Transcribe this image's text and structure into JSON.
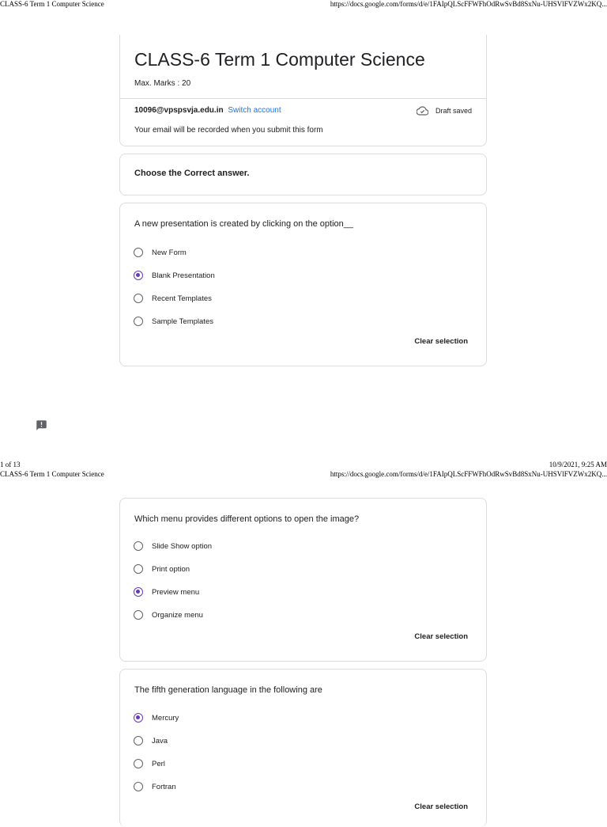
{
  "page1_header": {
    "left": "CLASS-6 Term 1 Computer Science",
    "right": "https://docs.google.com/forms/d/e/1FAIpQLScFFWFhOdRwSvBd8SxNu-UHSVlFVZWx2KQ..."
  },
  "page1_footer": {
    "left": "1 of 13",
    "right": "10/9/2021, 9:25 AM"
  },
  "page2_header": {
    "left": "CLASS-6 Term 1 Computer Science",
    "right": "https://docs.google.com/forms/d/e/1FAIpQLScFFWFhOdRwSvBd8SxNu-UHSVlFVZWx2KQ..."
  },
  "form": {
    "title": "CLASS-6 Term 1 Computer Science",
    "max_marks": "Max. Marks : 20",
    "email": "10096@vpspsvja.edu.in",
    "switch_account": "Switch account",
    "draft_status": "Draft saved",
    "email_note": "Your email will be recorded when you submit this form",
    "accent_color": "#673ab7"
  },
  "section": {
    "title": "Choose the Correct answer."
  },
  "clear_selection_label": "Clear selection",
  "questions": [
    {
      "text": "A new presentation is created by clicking on the option__",
      "options": [
        "New Form",
        "Blank Presentation",
        "Recent Templates",
        "Sample Templates"
      ],
      "selected": "Blank Presentation"
    },
    {
      "text": "Which menu provides different options to open the image?",
      "options": [
        "Slide Show option",
        "Print option",
        "Preview menu",
        "Organize menu"
      ],
      "selected": "Preview menu"
    },
    {
      "text": "The fifth generation language in the following are",
      "options": [
        "Mercury",
        "Java",
        "Perl",
        "Fortran"
      ],
      "selected": "Mercury"
    }
  ],
  "icons": {
    "draft": "cloud-check-icon",
    "feedback": "report-feedback-icon"
  }
}
